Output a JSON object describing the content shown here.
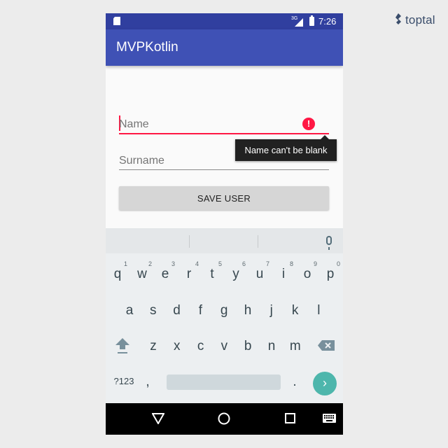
{
  "brand": {
    "name": "toptal"
  },
  "status_bar": {
    "network": "3G",
    "time": "7:26"
  },
  "app_bar": {
    "title": "MVPKotlin"
  },
  "form": {
    "name_placeholder": "Name",
    "name_error": "Name can't be blank",
    "surname_placeholder": "Surname",
    "save_label": "SAVE USER"
  },
  "keyboard": {
    "row1": [
      {
        "key": "q",
        "hint": "1"
      },
      {
        "key": "w",
        "hint": "2"
      },
      {
        "key": "e",
        "hint": "3"
      },
      {
        "key": "r",
        "hint": "4"
      },
      {
        "key": "t",
        "hint": "5"
      },
      {
        "key": "y",
        "hint": "6"
      },
      {
        "key": "u",
        "hint": "7"
      },
      {
        "key": "i",
        "hint": "8"
      },
      {
        "key": "o",
        "hint": "9"
      },
      {
        "key": "p",
        "hint": "0"
      }
    ],
    "row2": [
      "a",
      "s",
      "d",
      "f",
      "g",
      "h",
      "j",
      "k",
      "l"
    ],
    "row3": [
      "z",
      "x",
      "c",
      "v",
      "b",
      "n",
      "m"
    ],
    "symbols": "?123",
    "comma": ",",
    "period": "."
  },
  "icons": {
    "sd_card": "sd-card-icon",
    "signal": "signal-icon",
    "battery": "battery-charging-icon",
    "error": "error-icon",
    "mic": "mic-icon",
    "shift": "shift-icon",
    "backspace": "backspace-icon",
    "enter": "enter-arrow-icon",
    "back": "nav-back-icon",
    "home": "nav-home-icon",
    "recents": "nav-recents-icon",
    "keyboard": "keyboard-switch-icon"
  },
  "colors": {
    "primary": "#3f51b5",
    "primary_dark": "#303f9f",
    "error": "#ff1744",
    "accent": "#4db6ac"
  }
}
